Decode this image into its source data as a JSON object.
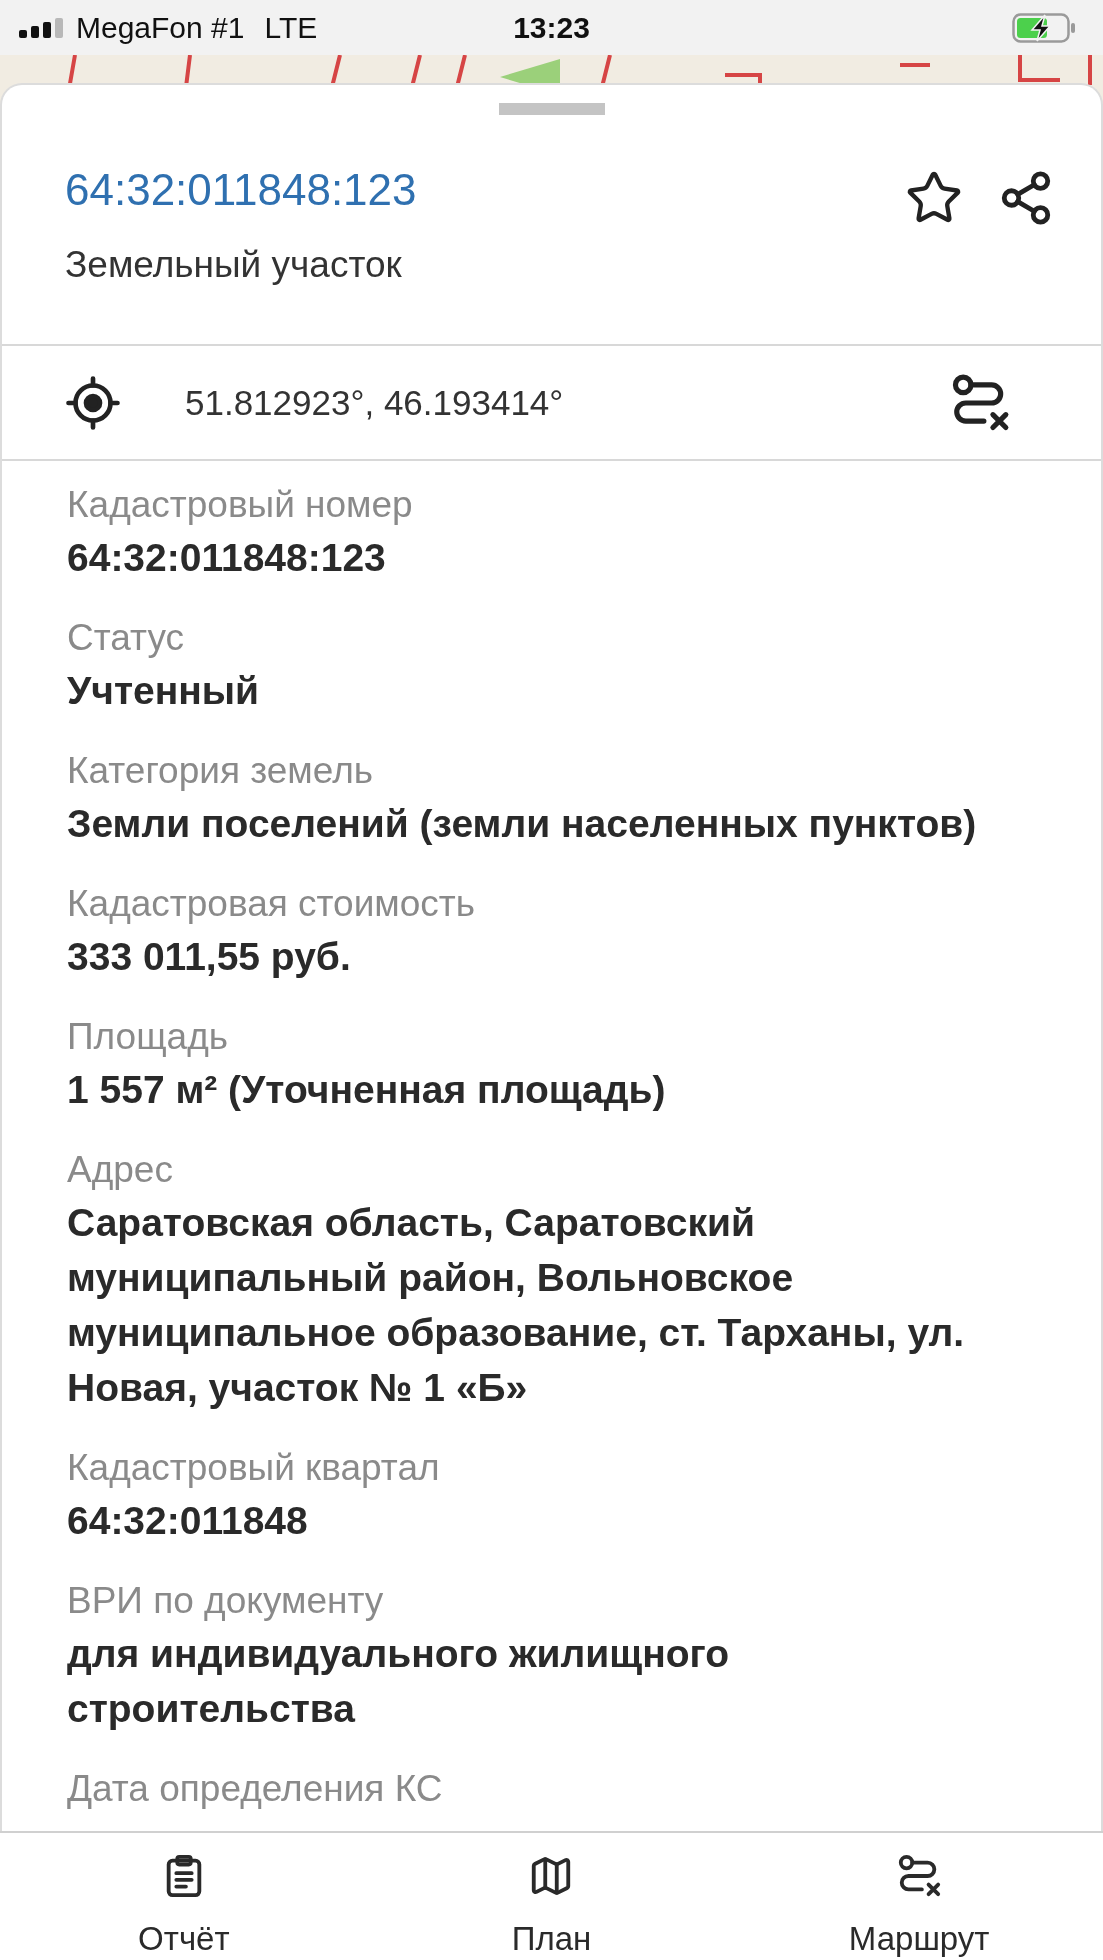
{
  "status_bar": {
    "carrier": "MegaFon #1",
    "network": "LTE",
    "time": "13:23"
  },
  "header": {
    "title": "64:32:011848:123",
    "subtitle": "Земельный участок",
    "favorite": false
  },
  "location": {
    "coordinates": "51.812923°, 46.193414°"
  },
  "fields": [
    {
      "label": "Кадастровый номер",
      "value": "64:32:011848:123"
    },
    {
      "label": "Статус",
      "value": "Учтенный"
    },
    {
      "label": "Категория земель",
      "value": "Земли поселений (земли населенных пунктов)"
    },
    {
      "label": "Кадастровая стоимость",
      "value": "333 011,55 руб."
    },
    {
      "label": "Площадь",
      "value": "1 557 м² (Уточненная площадь)"
    },
    {
      "label": "Адрес",
      "value": "Саратовская область, Саратовский муниципальный район, Вольновское муниципальное образование, ст. Тарханы, ул. Новая, участок № 1 «Б»"
    },
    {
      "label": "Кадастровый квартал",
      "value": "64:32:011848"
    },
    {
      "label": "ВРИ по документу",
      "value": "для индивидуального жилищного строительства"
    },
    {
      "label": "Дата определения КС"
    }
  ],
  "tab_bar": [
    {
      "kind": "report",
      "label": "Отчёт"
    },
    {
      "kind": "plan",
      "label": "План"
    },
    {
      "kind": "route",
      "label": "Маршрут"
    }
  ]
}
